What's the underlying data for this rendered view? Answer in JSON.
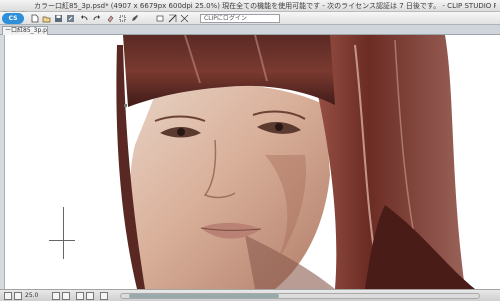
{
  "window": {
    "title": "カラー口紅85_3p.psd* (4907 x 6679px 600dpi 25.0%)  現在全ての機能を使用可能です - 次のライセンス認証は 7 日後です。 - CLIP STUDIO PAINT PRO"
  },
  "toolbar": {
    "logo_label": "CS",
    "buttons": [
      "new-icon",
      "open-icon",
      "save-icon",
      "save-as-icon",
      "undo-icon",
      "redo-icon",
      "erase-icon",
      "transform-icon",
      "pen-icon"
    ],
    "clip_menu_label": "CLIPにログイン"
  },
  "tabs": [
    {
      "label": "ー口紅85_3p.psd*"
    }
  ],
  "statusbar": {
    "zoom": "25.0"
  },
  "colors": {
    "accent": "#2f8fd8",
    "canvas_bg": "#ffffff",
    "chrome": "#e1e1e1"
  }
}
